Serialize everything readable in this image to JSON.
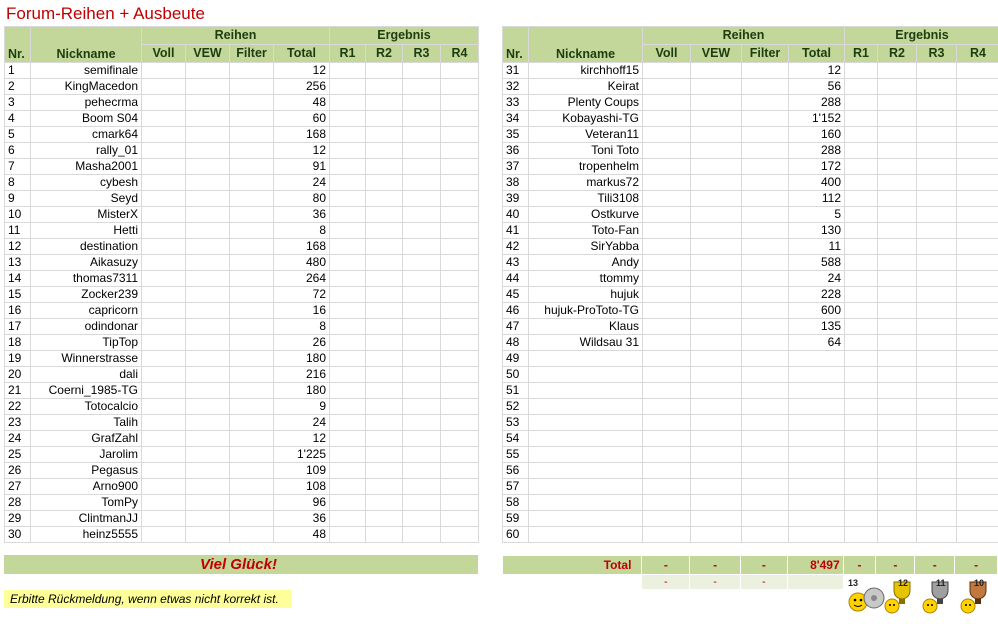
{
  "title": "Forum-Reihen + Ausbeute",
  "headers": {
    "reihen": "Reihen",
    "ergebnis": "Ergebnis",
    "nr": "Nr.",
    "nickname": "Nickname",
    "voll": "Voll",
    "vew": "VEW",
    "filter": "Filter",
    "total": "Total",
    "r1": "R1",
    "r2": "R2",
    "r3": "R3",
    "r4": "R4"
  },
  "left_rows": [
    {
      "nr": "1",
      "nick": "semifinale",
      "total": "12"
    },
    {
      "nr": "2",
      "nick": "KingMacedon",
      "total": "256"
    },
    {
      "nr": "3",
      "nick": "pehecrma",
      "total": "48"
    },
    {
      "nr": "4",
      "nick": "Boom S04",
      "total": "60"
    },
    {
      "nr": "5",
      "nick": "cmark64",
      "total": "168"
    },
    {
      "nr": "6",
      "nick": "rally_01",
      "total": "12"
    },
    {
      "nr": "7",
      "nick": "Masha2001",
      "total": "91"
    },
    {
      "nr": "8",
      "nick": "cybesh",
      "total": "24"
    },
    {
      "nr": "9",
      "nick": "Seyd",
      "total": "80"
    },
    {
      "nr": "10",
      "nick": "MisterX",
      "total": "36"
    },
    {
      "nr": "11",
      "nick": "Hetti",
      "total": "8"
    },
    {
      "nr": "12",
      "nick": "destination",
      "total": "168"
    },
    {
      "nr": "13",
      "nick": "Aikasuzy",
      "total": "480"
    },
    {
      "nr": "14",
      "nick": "thomas7311",
      "total": "264"
    },
    {
      "nr": "15",
      "nick": "Zocker239",
      "total": "72"
    },
    {
      "nr": "16",
      "nick": "capricorn",
      "total": "16"
    },
    {
      "nr": "17",
      "nick": "odindonar",
      "total": "8"
    },
    {
      "nr": "18",
      "nick": "TipTop",
      "total": "26"
    },
    {
      "nr": "19",
      "nick": "Winnerstrasse",
      "total": "180"
    },
    {
      "nr": "20",
      "nick": "dali",
      "total": "216"
    },
    {
      "nr": "21",
      "nick": "Coerni_1985-TG",
      "total": "180"
    },
    {
      "nr": "22",
      "nick": "Totocalcio",
      "total": "9"
    },
    {
      "nr": "23",
      "nick": "Talih",
      "total": "24"
    },
    {
      "nr": "24",
      "nick": "GrafZahl",
      "total": "12"
    },
    {
      "nr": "25",
      "nick": "Jarolim",
      "total": "1'225"
    },
    {
      "nr": "26",
      "nick": "Pegasus",
      "total": "109"
    },
    {
      "nr": "27",
      "nick": "Arno900",
      "total": "108"
    },
    {
      "nr": "28",
      "nick": "TomPy",
      "total": "96"
    },
    {
      "nr": "29",
      "nick": "ClintmanJJ",
      "total": "36"
    },
    {
      "nr": "30",
      "nick": "heinz5555",
      "total": "48"
    }
  ],
  "right_rows": [
    {
      "nr": "31",
      "nick": "kirchhoff15",
      "total": "12"
    },
    {
      "nr": "32",
      "nick": "Keirat",
      "total": "56"
    },
    {
      "nr": "33",
      "nick": "Plenty Coups",
      "total": "288"
    },
    {
      "nr": "34",
      "nick": "Kobayashi-TG",
      "total": "1'152"
    },
    {
      "nr": "35",
      "nick": "Veteran11",
      "total": "160"
    },
    {
      "nr": "36",
      "nick": "Toni Toto",
      "total": "288"
    },
    {
      "nr": "37",
      "nick": "tropenhelm",
      "total": "172"
    },
    {
      "nr": "38",
      "nick": "markus72",
      "total": "400"
    },
    {
      "nr": "39",
      "nick": "Tili3108",
      "total": "112"
    },
    {
      "nr": "40",
      "nick": "Ostkurve",
      "total": "5"
    },
    {
      "nr": "41",
      "nick": "Toto-Fan",
      "total": "130"
    },
    {
      "nr": "42",
      "nick": "SirYabba",
      "total": "11"
    },
    {
      "nr": "43",
      "nick": "Andy",
      "total": "588"
    },
    {
      "nr": "44",
      "nick": "ttommy",
      "total": "24"
    },
    {
      "nr": "45",
      "nick": "hujuk",
      "total": "228"
    },
    {
      "nr": "46",
      "nick": "hujuk-ProToto-TG",
      "total": "600"
    },
    {
      "nr": "47",
      "nick": "Klaus",
      "total": "135"
    },
    {
      "nr": "48",
      "nick": "Wildsau 31",
      "total": "64"
    },
    {
      "nr": "49",
      "nick": "",
      "total": ""
    },
    {
      "nr": "50",
      "nick": "",
      "total": ""
    },
    {
      "nr": "51",
      "nick": "",
      "total": ""
    },
    {
      "nr": "52",
      "nick": "",
      "total": ""
    },
    {
      "nr": "53",
      "nick": "",
      "total": ""
    },
    {
      "nr": "54",
      "nick": "",
      "total": ""
    },
    {
      "nr": "55",
      "nick": "",
      "total": ""
    },
    {
      "nr": "56",
      "nick": "",
      "total": ""
    },
    {
      "nr": "57",
      "nick": "",
      "total": ""
    },
    {
      "nr": "58",
      "nick": "",
      "total": ""
    },
    {
      "nr": "59",
      "nick": "",
      "total": ""
    },
    {
      "nr": "60",
      "nick": "",
      "total": ""
    }
  ],
  "footer": {
    "glueck": "Viel Glück!",
    "total_label": "Total",
    "voll": "-",
    "vew": "-",
    "filter": "-",
    "total": "8'497",
    "r1": "-",
    "r2": "-",
    "r3": "-",
    "r4": "-",
    "sub_voll": "-",
    "sub_vew": "-",
    "sub_filter": "-",
    "note": "Erbitte Rückmeldung, wenn etwas nicht korrekt ist."
  },
  "badges": [
    {
      "icon": "trophy-13-icon",
      "label": "13"
    },
    {
      "icon": "trophy-12-icon",
      "label": "12"
    },
    {
      "icon": "trophy-11-icon",
      "label": "11"
    },
    {
      "icon": "trophy-10-icon",
      "label": "10"
    }
  ],
  "colors": {
    "accent": "#c4d79b",
    "title": "#c00000",
    "note_bg": "#ffff99"
  }
}
